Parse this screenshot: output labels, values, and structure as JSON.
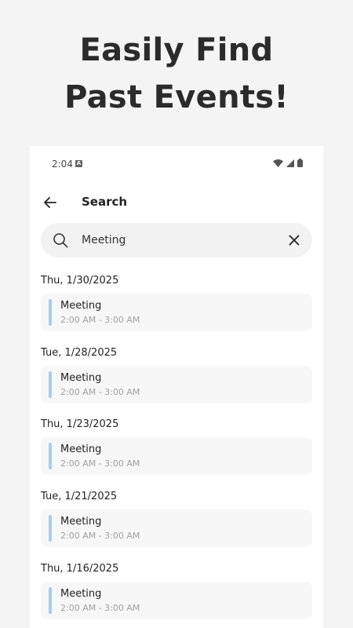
{
  "promo": {
    "line1": "Easily Find",
    "line2": "Past Events!"
  },
  "status": {
    "time": "2:04",
    "notification_icon": "a-badge-icon",
    "icons": [
      "wifi-icon",
      "signal-icon",
      "battery-icon"
    ]
  },
  "appbar": {
    "back_icon": "arrow-left-icon",
    "title": "Search"
  },
  "search": {
    "value": "Meeting",
    "search_icon": "search-icon",
    "clear_icon": "close-icon"
  },
  "accent_color": "#a6cdee",
  "results": [
    {
      "date": "Thu, 1/30/2025",
      "title": "Meeting",
      "time": "2:00 AM - 3:00 AM"
    },
    {
      "date": "Tue, 1/28/2025",
      "title": "Meeting",
      "time": "2:00 AM - 3:00 AM"
    },
    {
      "date": "Thu, 1/23/2025",
      "title": "Meeting",
      "time": "2:00 AM - 3:00 AM"
    },
    {
      "date": "Tue, 1/21/2025",
      "title": "Meeting",
      "time": "2:00 AM - 3:00 AM"
    },
    {
      "date": "Thu, 1/16/2025",
      "title": "Meeting",
      "time": "2:00 AM - 3:00 AM"
    }
  ]
}
